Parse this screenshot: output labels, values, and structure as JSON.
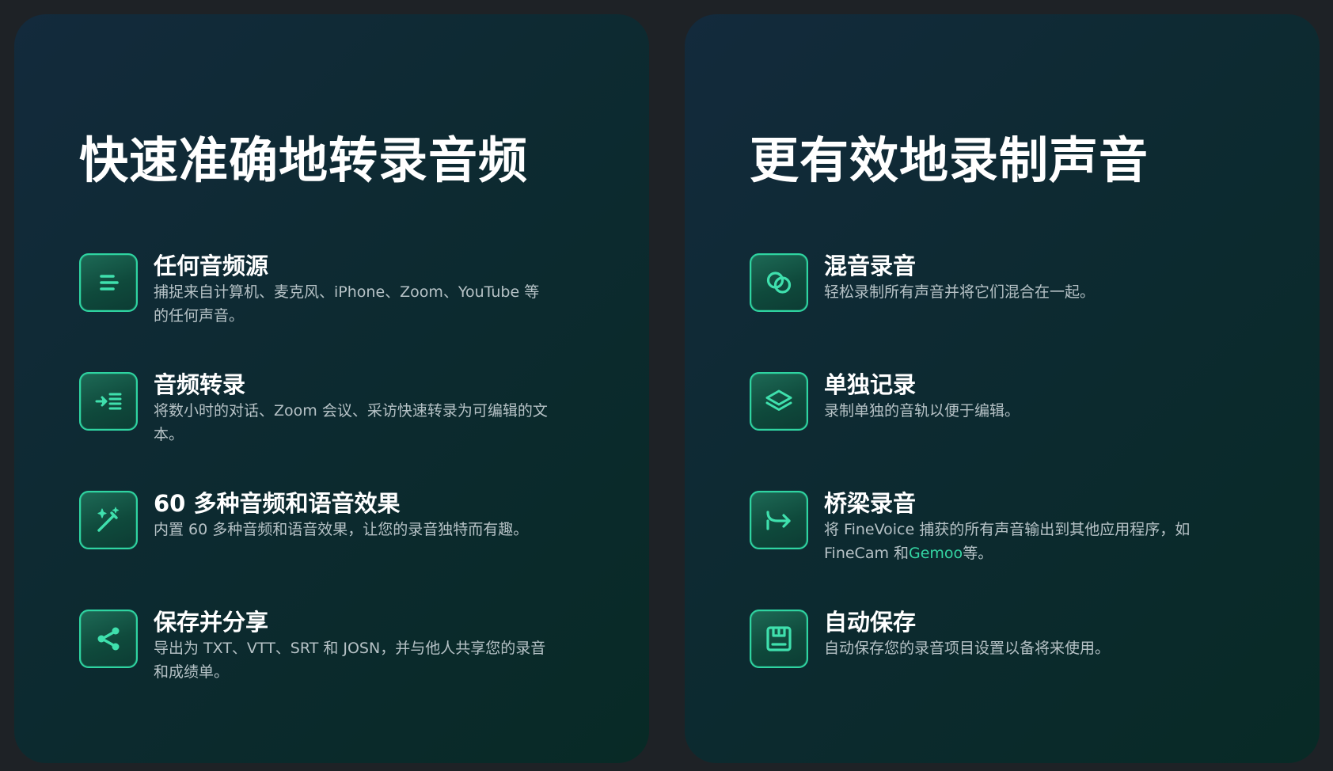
{
  "left": {
    "title": "快速准确地转录音频",
    "features": [
      {
        "icon": "text-lines-icon",
        "title": "任何音频源",
        "desc": "捕捉来自计算机、麦克风、iPhone、Zoom、YouTube 等的任何声音。"
      },
      {
        "icon": "transcribe-icon",
        "title": "音频转录",
        "desc": "将数小时的对话、Zoom 会议、采访快速转录为可编辑的文本。"
      },
      {
        "icon": "magic-wand-icon",
        "title": "60 多种音频和语音效果",
        "desc": "内置 60 多种音频和语音效果，让您的录音独特而有趣。"
      },
      {
        "icon": "share-icon",
        "title": "保存并分享",
        "desc": "导出为 TXT、VTT、SRT 和 JOSN，并与他人共享您的录音和成绩单。"
      }
    ]
  },
  "right": {
    "title": "更有效地录制声音",
    "features": [
      {
        "icon": "mix-circles-icon",
        "title": "混音录音",
        "desc": "轻松录制所有声音并将它们混合在一起。"
      },
      {
        "icon": "layers-icon",
        "title": "单独记录",
        "desc": "录制单独的音轨以便于编辑。"
      },
      {
        "icon": "bridge-arrow-icon",
        "title": "桥梁录音",
        "desc_before": "将 FineVoice 捕获的所有声音输出到其他应用程序，如 FineCam 和",
        "desc_link": "Gemoo",
        "desc_after": "等。"
      },
      {
        "icon": "save-disk-icon",
        "title": "自动保存",
        "desc": "自动保存您的录音项目设置以备将来使用。"
      }
    ]
  },
  "colors": {
    "background": "#1e2226",
    "accent": "#34d6a3",
    "title": "#ffffff",
    "desc": "#b6c2c6"
  }
}
